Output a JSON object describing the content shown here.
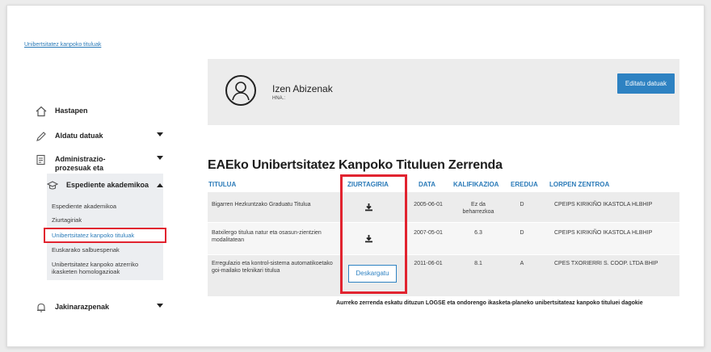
{
  "breadcrumb": "Unibertsitatez kanpoko tituluak",
  "sidebar": {
    "items": [
      {
        "label": "Hastapen"
      },
      {
        "label": "Aldatu datuak"
      },
      {
        "label": "Administrazio-prozesuak eta laguntzak"
      },
      {
        "label": "Espediente akademikoa"
      },
      {
        "label": "Jakinarazpenak"
      }
    ],
    "submenu": [
      "Espediente akademikoa",
      "Ziurtagiriak",
      "Unibertsitatez kanpoko tituluak",
      "Euskarako salbuespenak",
      "Unibertsitatez kanpoko atzerriko ikasketen homologazioak"
    ]
  },
  "profile": {
    "name": "Izen Abizenak",
    "hna": "HNA.:",
    "edit_label": "Editatu datuak"
  },
  "table": {
    "title": "EAEko Unibertsitatez Kanpoko Tituluen Zerrenda",
    "headers": [
      "TITULUA",
      "ZIURTAGIRIA",
      "DATA",
      "KALIFIKAZIOA",
      "EREDUA",
      "LORPEN ZENTROA"
    ],
    "rows": [
      {
        "titulua": "Bigarren Hezkuntzako Graduatu Titulua",
        "data": "2005-06-01",
        "kalifikazioa": "Ez da beharrezkoa",
        "eredua": "D",
        "zentroa": "CPEIPS KIRIKIÑO IKASTOLA HLBHIP"
      },
      {
        "titulua": "Batxilergo titulua natur eta osasun-zientzien modalitatean",
        "data": "2007-05-01",
        "kalifikazioa": "6.3",
        "eredua": "D",
        "zentroa": "CPEIPS KIRIKIÑO IKASTOLA HLBHIP"
      },
      {
        "titulua": "Erregulazio eta kontrol-sistema automatikoetako goi-mailako teknikari titulua",
        "data": "2011-06-01",
        "kalifikazioa": "8.1",
        "eredua": "A",
        "zentroa": "CPES TXORIERRI S. COOP. LTDA BHIP"
      }
    ],
    "download_label": "Deskargatu",
    "footnote": "Aurreko zerrenda eskatu dituzun LOGSE eta ondorengo ikasketa-planeko unibertsitateaz kanpoko tituluei dagokie"
  },
  "colors": {
    "accent": "#2e82c2",
    "highlight": "#e1232f"
  },
  "icons": [
    "home-icon",
    "pencil-icon",
    "document-icon",
    "graduation-cap-icon",
    "bell-icon",
    "user-avatar-icon",
    "download-icon"
  ]
}
